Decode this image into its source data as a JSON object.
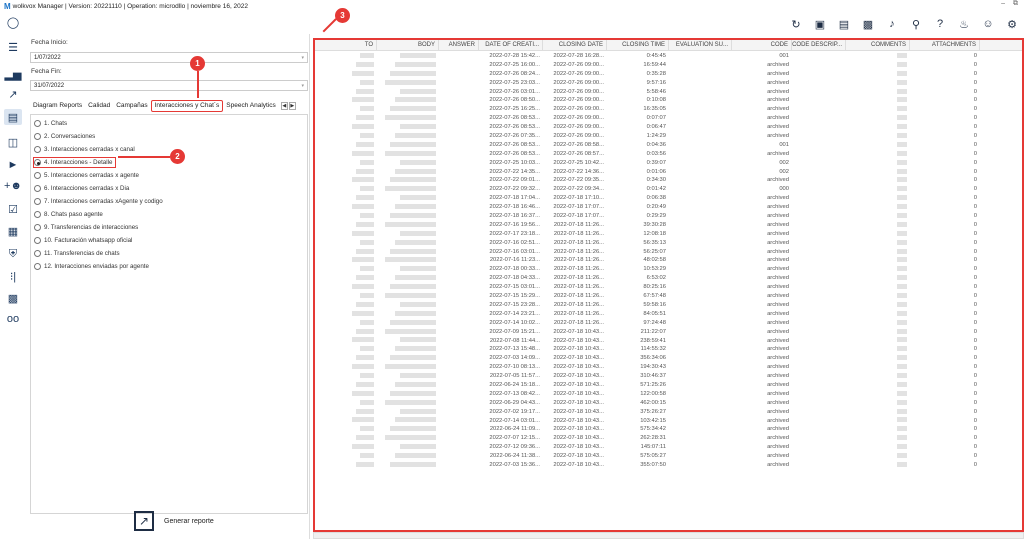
{
  "app": {
    "logo": "M",
    "title": "wolkvox Manager  | Version: 20221110  |  Operation: microdllo  |  noviembre 16, 2022",
    "window_controls": [
      "–",
      "⧉"
    ]
  },
  "rail_icons": [
    "user-circle-icon",
    "menu-icon",
    "bar-chart-icon",
    "trend-icon",
    "report-icon",
    "org-chart-icon",
    "megaphone-icon",
    "add-group-icon",
    "checklist-icon",
    "calculator-icon",
    "shield-icon",
    "audio-wave-icon",
    "video-add-icon",
    "voicemail-icon"
  ],
  "toolbar_icons": [
    "refresh-icon",
    "briefcase-icon",
    "contact-card-icon",
    "id-card-icon",
    "music-icon",
    "microphone-icon",
    "help-icon",
    "bell-icon",
    "user-icon",
    "settings-icon"
  ],
  "filters": {
    "start_label": "Fecha Inicio:",
    "start_value": "1/07/2022",
    "end_label": "Fecha Fin:",
    "end_value": "31/07/2022"
  },
  "tabs": [
    "Diagram Reports",
    "Calidad",
    "Campañas",
    "Interacciones y Chat´s",
    "Speech Analytics"
  ],
  "selected_tab": "Interacciones y Chat´s",
  "reports": [
    "1. Chats",
    "2. Conversaciones",
    "3. Interacciones cerradas x canal",
    "4. Interacciones - Detalle",
    "5. Interacciones cerradas x agente",
    "6. Interacciones cerradas x Dia",
    "7. Interacciones cerradas xAgente y codigo",
    "8. Chats paso agente",
    "9. Transferencias de interacciones",
    "10. Facturación whatsapp oficial",
    "11. Transferencias de chats",
    "12. Interacciones enviadas por agente"
  ],
  "selected_report": "4. Interacciones - Detalle",
  "generate_label": "Generar reporte",
  "badges": [
    "1",
    "2",
    "3"
  ],
  "colors": {
    "accent": "#e53935",
    "icon": "#1e2d44"
  },
  "grid": {
    "columns": [
      "TO",
      "BODY",
      "ANSWER",
      "DATE OF CREATI...",
      "CLOSING DATE",
      "CLOSING TIME",
      "EVALUATION SU...",
      "CODE",
      "CODE DESCRIP...",
      "COMMENTS",
      "ATTACHMENTS"
    ],
    "rows": [
      [
        "2022-07-28 15:42...",
        "2022-07-28 16:28...",
        "0:45:45",
        "001",
        "0"
      ],
      [
        "2022-07-25 16:00...",
        "2022-07-26 09:00...",
        "16:59:44",
        "archived",
        "0"
      ],
      [
        "2022-07-26 08:24...",
        "2022-07-26 09:00...",
        "0:35:28",
        "archived",
        "0"
      ],
      [
        "2022-07-25 23:03...",
        "2022-07-26 09:00...",
        "9:57:16",
        "archived",
        "0"
      ],
      [
        "2022-07-26 03:01...",
        "2022-07-26 09:00...",
        "5:58:46",
        "archived",
        "0"
      ],
      [
        "2022-07-26 08:50...",
        "2022-07-26 09:00...",
        "0:10:08",
        "archived",
        "0"
      ],
      [
        "2022-07-25 16:25...",
        "2022-07-26 09:00...",
        "16:35:05",
        "archived",
        "0"
      ],
      [
        "2022-07-26 08:53...",
        "2022-07-26 09:00...",
        "0:07:07",
        "archived",
        "0"
      ],
      [
        "2022-07-26 08:53...",
        "2022-07-26 09:00...",
        "0:06:47",
        "archived",
        "0"
      ],
      [
        "2022-07-26 07:35...",
        "2022-07-26 09:00...",
        "1:24:29",
        "archived",
        "0"
      ],
      [
        "2022-07-26 08:53...",
        "2022-07-26 08:58...",
        "0:04:36",
        "001",
        "0"
      ],
      [
        "2022-07-26 08:53...",
        "2022-07-26 08:57...",
        "0:03:56",
        "archived",
        "0"
      ],
      [
        "2022-07-25 10:03...",
        "2022-07-25 10:42...",
        "0:39:07",
        "002",
        "0"
      ],
      [
        "2022-07-22 14:35...",
        "2022-07-22 14:36...",
        "0:01:06",
        "002",
        "0"
      ],
      [
        "2022-07-22 09:01...",
        "2022-07-22 09:35...",
        "0:34:30",
        "archived",
        "0"
      ],
      [
        "2022-07-22 09:32...",
        "2022-07-22 09:34...",
        "0:01:42",
        "000",
        "0"
      ],
      [
        "2022-07-18 17:04...",
        "2022-07-18 17:10...",
        "0:06:38",
        "archived",
        "0"
      ],
      [
        "2022-07-18 16:46...",
        "2022-07-18 17:07...",
        "0:20:49",
        "archived",
        "0"
      ],
      [
        "2022-07-18 16:37...",
        "2022-07-18 17:07...",
        "0:29:29",
        "archived",
        "0"
      ],
      [
        "2022-07-16 19:56...",
        "2022-07-18 11:26...",
        "39:30:28",
        "archived",
        "0"
      ],
      [
        "2022-07-17 23:18...",
        "2022-07-18 11:26...",
        "12:08:18",
        "archived",
        "0"
      ],
      [
        "2022-07-16 02:51...",
        "2022-07-18 11:26...",
        "56:35:13",
        "archived",
        "0"
      ],
      [
        "2022-07-16 03:01...",
        "2022-07-18 11:26...",
        "56:25:07",
        "archived",
        "0"
      ],
      [
        "2022-07-16 11:23...",
        "2022-07-18 11:26...",
        "48:02:58",
        "archived",
        "0"
      ],
      [
        "2022-07-18 00:33...",
        "2022-07-18 11:26...",
        "10:53:29",
        "archived",
        "0"
      ],
      [
        "2022-07-18 04:33...",
        "2022-07-18 11:26...",
        "6:53:02",
        "archived",
        "0"
      ],
      [
        "2022-07-15 03:01...",
        "2022-07-18 11:26...",
        "80:25:16",
        "archived",
        "0"
      ],
      [
        "2022-07-15 15:29...",
        "2022-07-18 11:26...",
        "67:57:48",
        "archived",
        "0"
      ],
      [
        "2022-07-15 23:28...",
        "2022-07-18 11:26...",
        "59:58:16",
        "archived",
        "0"
      ],
      [
        "2022-07-14 23:21...",
        "2022-07-18 11:26...",
        "84:05:51",
        "archived",
        "0"
      ],
      [
        "2022-07-14 10:02...",
        "2022-07-18 11:26...",
        "97:24:48",
        "archived",
        "0"
      ],
      [
        "2022-07-09 15:21...",
        "2022-07-18 10:43...",
        "211:22:07",
        "archived",
        "0"
      ],
      [
        "2022-07-08 11:44...",
        "2022-07-18 10:43...",
        "238:59:41",
        "archived",
        "0"
      ],
      [
        "2022-07-13 15:48...",
        "2022-07-18 10:43...",
        "114:55:32",
        "archived",
        "0"
      ],
      [
        "2022-07-03 14:09...",
        "2022-07-18 10:43...",
        "356:34:06",
        "archived",
        "0"
      ],
      [
        "2022-07-10 08:13...",
        "2022-07-18 10:43...",
        "194:30:43",
        "archived",
        "0"
      ],
      [
        "2022-07-05 11:57...",
        "2022-07-18 10:43...",
        "310:46:37",
        "archived",
        "0"
      ],
      [
        "2022-06-24 15:18...",
        "2022-07-18 10:43...",
        "571:25:26",
        "archived",
        "0"
      ],
      [
        "2022-07-13 08:42...",
        "2022-07-18 10:43...",
        "122:00:58",
        "archived",
        "0"
      ],
      [
        "2022-06-29 04:43...",
        "2022-07-18 10:43...",
        "462:00:15",
        "archived",
        "0"
      ],
      [
        "2022-07-02 19:17...",
        "2022-07-18 10:43...",
        "375:26:27",
        "archived",
        "0"
      ],
      [
        "2022-07-14 03:01...",
        "2022-07-18 10:43...",
        "103:42:15",
        "archived",
        "0"
      ],
      [
        "2022-06-24 11:09...",
        "2022-07-18 10:43...",
        "575:34:42",
        "archived",
        "0"
      ],
      [
        "2022-07-07 12:15...",
        "2022-07-18 10:43...",
        "262:28:31",
        "archived",
        "0"
      ],
      [
        "2022-07-12 09:36...",
        "2022-07-18 10:43...",
        "145:07:11",
        "archived",
        "0"
      ],
      [
        "2022-06-24 11:38...",
        "2022-07-18 10:43...",
        "575:05:27",
        "archived",
        "0"
      ],
      [
        "2022-07-03 15:36...",
        "2022-07-18 10:43...",
        "355:07:50",
        "archived",
        "0"
      ]
    ]
  }
}
